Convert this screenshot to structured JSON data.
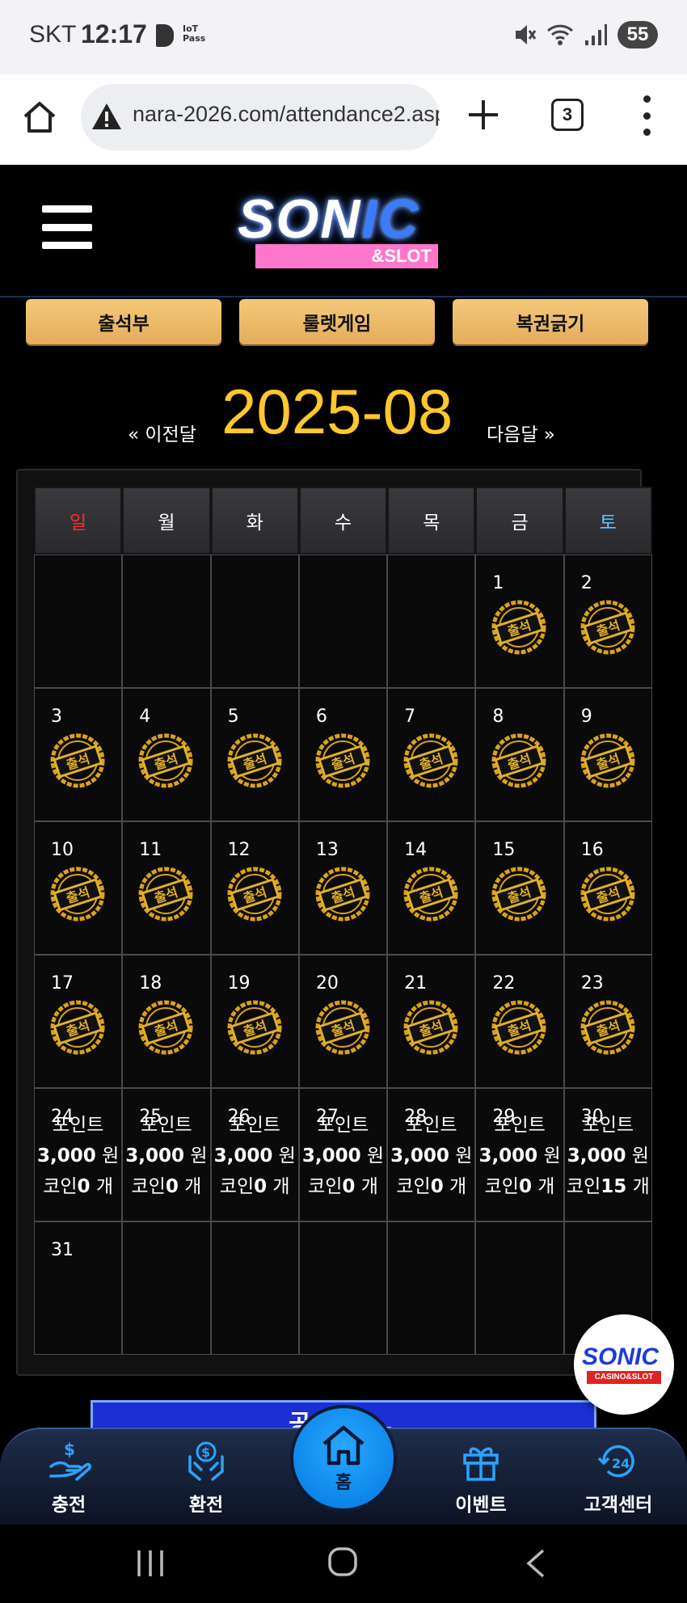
{
  "status_bar": {
    "carrier": "SKT",
    "time": "12:17",
    "iot_label": "IoT\nPass",
    "battery": "55"
  },
  "browser": {
    "url": "nara-2026.com/attendance2.asp",
    "tab_count": "3"
  },
  "nav_buttons": [
    "출석부",
    "룰렛게임",
    "복권긁기"
  ],
  "month": {
    "prev_label": "« 이전달",
    "title": "2025-08",
    "next_label": "다음달 »"
  },
  "weekdays": [
    "일",
    "월",
    "화",
    "수",
    "목",
    "금",
    "토"
  ],
  "weekday_colors": {
    "sunday": "#ff2a2a",
    "saturday": "#5ec8ff",
    "default": "#ffffff"
  },
  "stamp_label": "출석",
  "accent_gold": "#ffc72c",
  "calendar": {
    "weeks": [
      [
        null,
        null,
        null,
        null,
        null,
        {
          "day": "1",
          "type": "stamp"
        },
        {
          "day": "2",
          "type": "stamp"
        }
      ],
      [
        {
          "day": "3",
          "type": "stamp"
        },
        {
          "day": "4",
          "type": "stamp"
        },
        {
          "day": "5",
          "type": "stamp"
        },
        {
          "day": "6",
          "type": "stamp"
        },
        {
          "day": "7",
          "type": "stamp"
        },
        {
          "day": "8",
          "type": "stamp"
        },
        {
          "day": "9",
          "type": "stamp"
        }
      ],
      [
        {
          "day": "10",
          "type": "stamp"
        },
        {
          "day": "11",
          "type": "stamp"
        },
        {
          "day": "12",
          "type": "stamp"
        },
        {
          "day": "13",
          "type": "stamp"
        },
        {
          "day": "14",
          "type": "stamp"
        },
        {
          "day": "15",
          "type": "stamp"
        },
        {
          "day": "16",
          "type": "stamp"
        }
      ],
      [
        {
          "day": "17",
          "type": "stamp"
        },
        {
          "day": "18",
          "type": "stamp"
        },
        {
          "day": "19",
          "type": "stamp"
        },
        {
          "day": "20",
          "type": "stamp"
        },
        {
          "day": "21",
          "type": "stamp"
        },
        {
          "day": "22",
          "type": "stamp"
        },
        {
          "day": "23",
          "type": "stamp"
        }
      ],
      [
        {
          "day": "24",
          "type": "info",
          "line1": "포인트",
          "amount": "3,000",
          "unit1": " 원",
          "coin_prefix": "코인",
          "coin": "0",
          "unit2": " 개"
        },
        {
          "day": "25",
          "type": "info",
          "line1": "포인트",
          "amount": "3,000",
          "unit1": " 원",
          "coin_prefix": "코인",
          "coin": "0",
          "unit2": " 개"
        },
        {
          "day": "26",
          "type": "info",
          "line1": "포인트",
          "amount": "3,000",
          "unit1": " 원",
          "coin_prefix": "코인",
          "coin": "0",
          "unit2": " 개"
        },
        {
          "day": "27",
          "type": "info",
          "line1": "포인트",
          "amount": "3,000",
          "unit1": " 원",
          "coin_prefix": "코인",
          "coin": "0",
          "unit2": " 개"
        },
        {
          "day": "28",
          "type": "info",
          "line1": "포인트",
          "amount": "3,000",
          "unit1": " 원",
          "coin_prefix": "코인",
          "coin": "0",
          "unit2": " 개"
        },
        {
          "day": "29",
          "type": "info",
          "line1": "포인트",
          "amount": "3,000",
          "unit1": " 원",
          "coin_prefix": "코인",
          "coin": "0",
          "unit2": " 개"
        },
        {
          "day": "30",
          "type": "info",
          "line1": "포인트",
          "amount": "3,000",
          "unit1": " 원",
          "coin_prefix": "코인",
          "coin": "15",
          "unit2": " 개"
        }
      ],
      [
        {
          "day": "31",
          "type": "plain"
        },
        null,
        null,
        null,
        null,
        null,
        null
      ]
    ]
  },
  "banner_text": "공지 ...",
  "bottom_nav": {
    "charge": "충전",
    "exchange": "환전",
    "home": "홈",
    "event": "이벤트",
    "support": "고객센터"
  }
}
